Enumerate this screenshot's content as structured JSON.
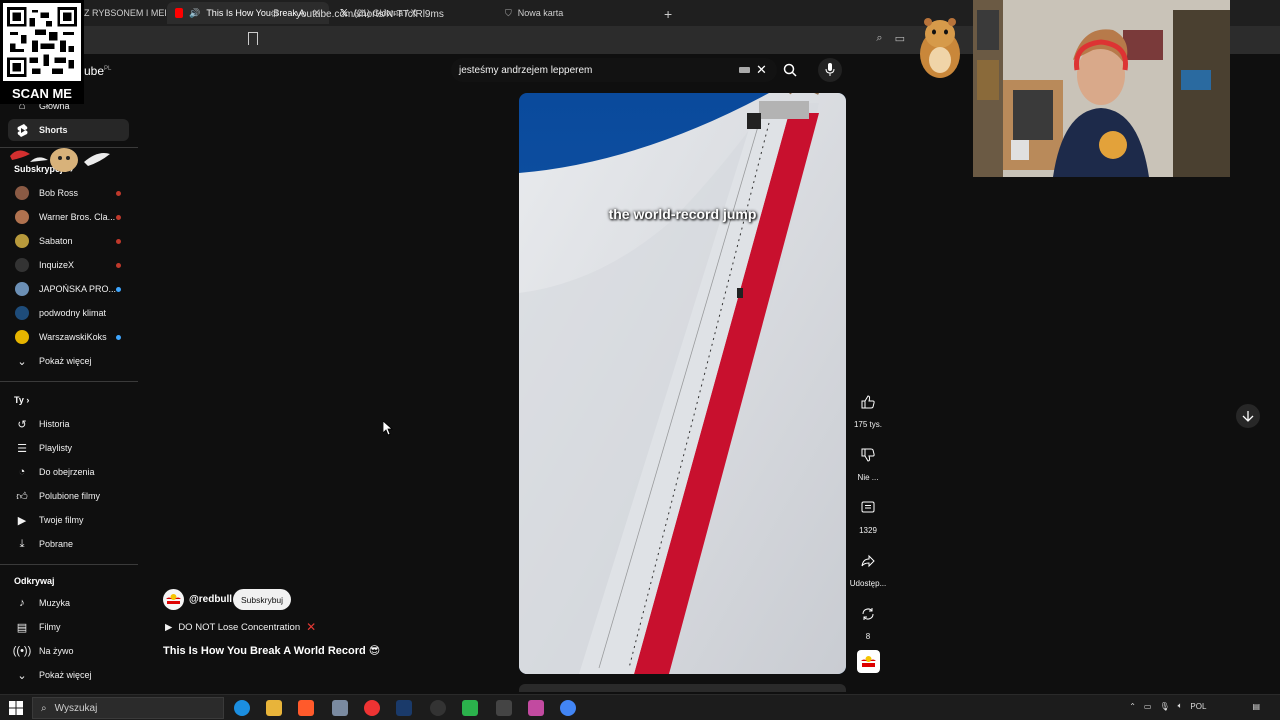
{
  "browser": {
    "tabs": [
      {
        "label": "Z RYBSONEM I MEDI",
        "active": false
      },
      {
        "label": "This Is How You Break A World",
        "active": true
      },
      {
        "label": "(21) Główna / X",
        "active": false
      },
      {
        "label": "Nowa karta",
        "active": false
      }
    ],
    "url": "youtube.com/shorts/N-TTcfRl9ms"
  },
  "overlay": {
    "qr_caption": "SCAN ME"
  },
  "youtube": {
    "logo_suffix": "ube",
    "logo_region": "PL",
    "search_query": "jesteśmy andrzejem lepperem"
  },
  "sidebar": {
    "main": [
      {
        "label": "Główna",
        "icon": "home-icon"
      },
      {
        "label": "Shorts",
        "icon": "shorts-icon",
        "active": true
      }
    ],
    "subs_heading": "Subskrypcje",
    "subscriptions": [
      {
        "label": "Bob Ross",
        "color": "#8a5a44",
        "live": "#c0392b"
      },
      {
        "label": "Warner Bros. Cla...",
        "color": "#b0724f",
        "live": "#c0392b"
      },
      {
        "label": "Sabaton",
        "color": "#b89a3c",
        "live": "#c0392b"
      },
      {
        "label": "InquizeX",
        "color": "#333333",
        "live": "#c0392b"
      },
      {
        "label": "JAPOŃSKA PRO...",
        "color": "#6b8fb5",
        "live": "#3ea6ff"
      },
      {
        "label": "podwodny klimat",
        "color": "#1e4c7a",
        "live": ""
      },
      {
        "label": "WarszawskiKoks",
        "color": "#e6b400",
        "live": "#3ea6ff"
      }
    ],
    "show_more_1": "Pokaż więcej",
    "you_heading": "Ty",
    "you": [
      {
        "label": "Historia",
        "icon": "history-icon"
      },
      {
        "label": "Playlisty",
        "icon": "playlist-icon"
      },
      {
        "label": "Do obejrzenia",
        "icon": "watch-later-icon"
      },
      {
        "label": "Polubione filmy",
        "icon": "like-icon"
      },
      {
        "label": "Twoje filmy",
        "icon": "video-icon"
      },
      {
        "label": "Pobrane",
        "icon": "download-icon"
      }
    ],
    "explore_heading": "Odkrywaj",
    "explore": [
      {
        "label": "Muzyka",
        "icon": "music-icon"
      },
      {
        "label": "Filmy",
        "icon": "film-icon"
      },
      {
        "label": "Na żywo",
        "icon": "live-icon"
      }
    ],
    "show_more_2": "Pokaż więcej"
  },
  "short": {
    "overlay_caption": "the world-record jump",
    "channel": "@redbull",
    "subscribe_label": "Subskrybuj",
    "playlist_label": "DO NOT Lose Concentration",
    "title": "This Is How You Break A World Record 😎",
    "actions": {
      "likes": "175 tys.",
      "dislike": "Nie ...",
      "comments": "1329",
      "share": "Udostęp...",
      "remix": "8"
    }
  },
  "taskbar": {
    "search_placeholder": "Wyszukaj",
    "language": "POL"
  }
}
